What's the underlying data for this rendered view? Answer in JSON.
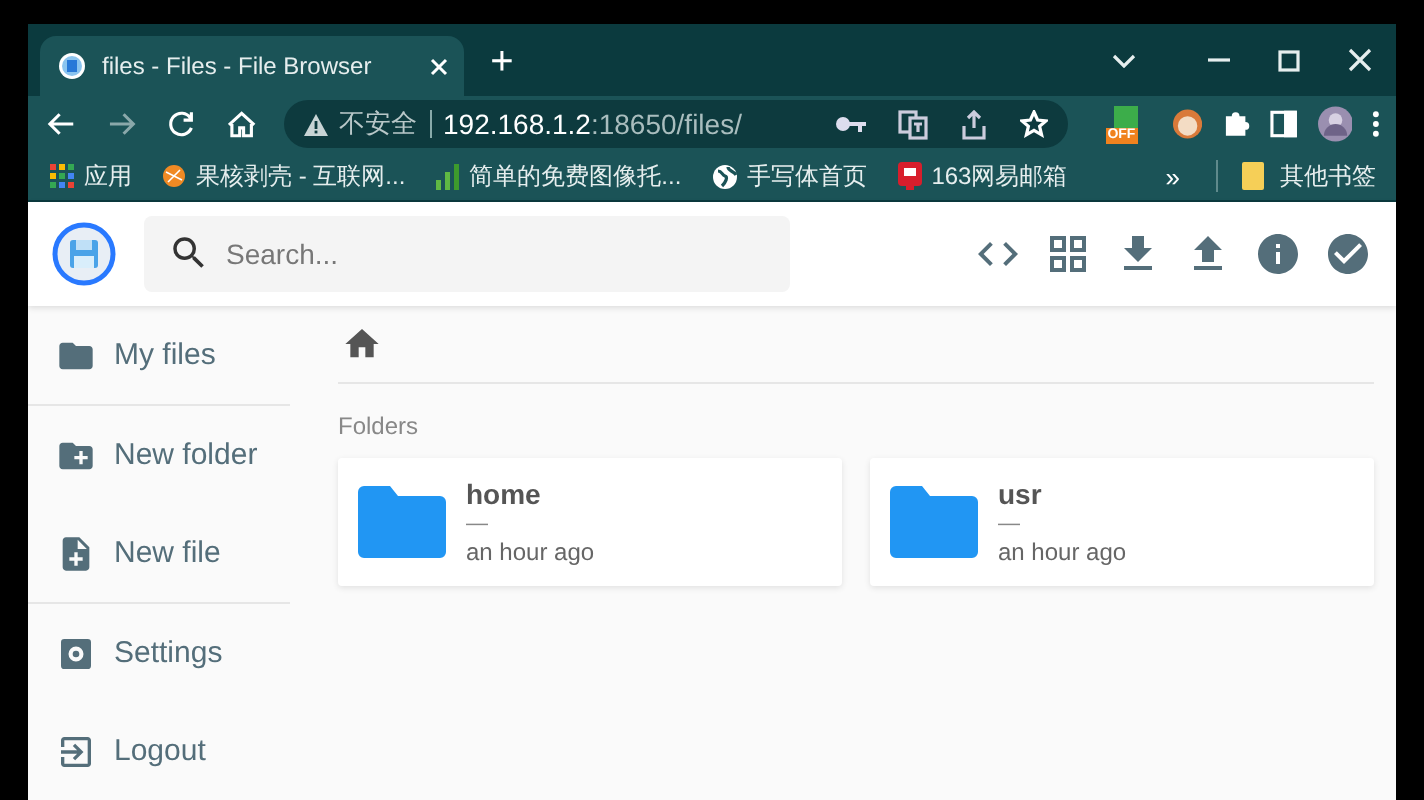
{
  "browser": {
    "tab_title": "files - Files - File Browser",
    "new_tab": "+",
    "security_label": "不安全",
    "url_host": "192.168.1.2",
    "url_rest": ":18650/files/",
    "extension_badge": "OFF",
    "bookmarks": [
      {
        "label": "应用",
        "kind": "apps"
      },
      {
        "label": "果核剥壳 - 互联网...",
        "kind": "orange"
      },
      {
        "label": "简单的免费图像托...",
        "kind": "bars"
      },
      {
        "label": "手写体首页",
        "kind": "globe"
      },
      {
        "label": "163网易邮箱",
        "kind": "mail"
      }
    ],
    "more": "»",
    "other_bookmarks": "其他书签"
  },
  "header": {
    "search": {
      "placeholder": "Search..."
    }
  },
  "sidebar": {
    "groups": [
      [
        {
          "label": "My files",
          "kind": "folder"
        }
      ],
      [
        {
          "label": "New folder",
          "kind": "new-folder"
        },
        {
          "label": "New file",
          "kind": "new-file"
        }
      ],
      [
        {
          "label": "Settings",
          "kind": "settings"
        },
        {
          "label": "Logout",
          "kind": "logout"
        }
      ]
    ]
  },
  "section_title": "Folders",
  "folders": [
    {
      "name": "home",
      "size": "—",
      "modified": "an hour ago"
    },
    {
      "name": "usr",
      "size": "—",
      "modified": "an hour ago"
    }
  ]
}
